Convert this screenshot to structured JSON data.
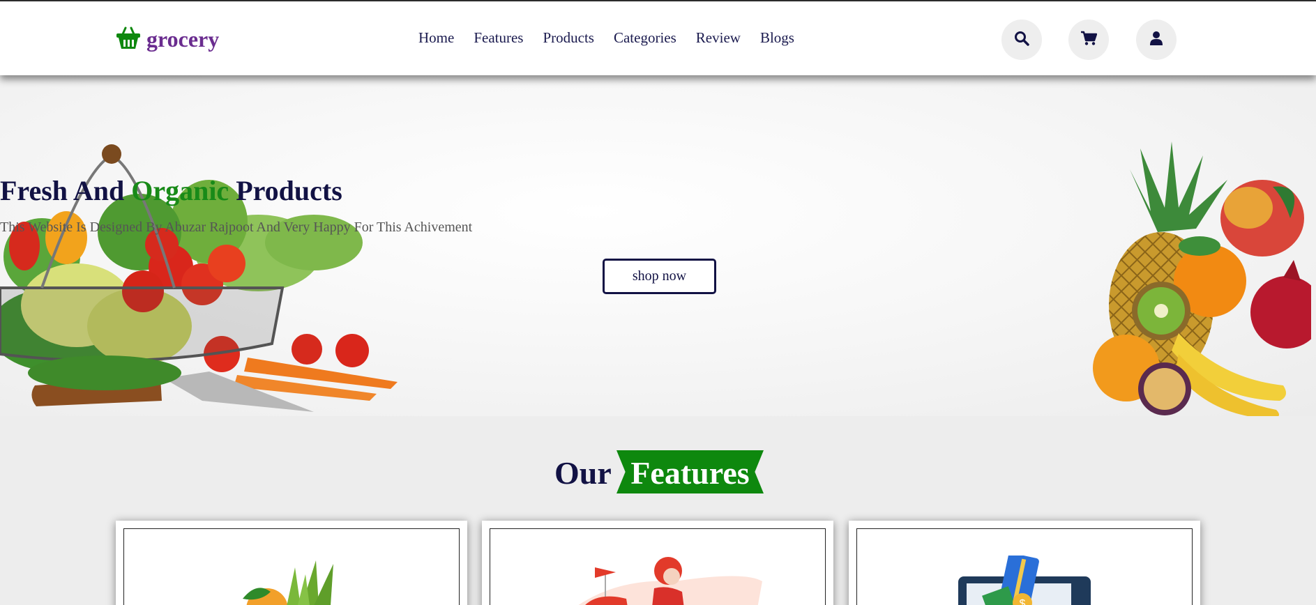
{
  "header": {
    "logo_text": "grocery",
    "nav": [
      "Home",
      "Features",
      "Products",
      "Categories",
      "Review",
      "Blogs"
    ],
    "icons": [
      "search-icon",
      "cart-icon",
      "user-icon"
    ]
  },
  "hero": {
    "title_part1": "Fresh And",
    "title_accent": "Organic",
    "title_part2": "Products",
    "subtitle": "This Website Is Designed By Abuzar Rajpoot And Very Happy For This Achivement",
    "button_label": "shop now"
  },
  "features": {
    "heading_plain": "Our",
    "heading_ribbon": "Features"
  },
  "colors": {
    "brand_purple": "#6a2c8f",
    "brand_green": "#0e880e",
    "navy": "#121244"
  }
}
